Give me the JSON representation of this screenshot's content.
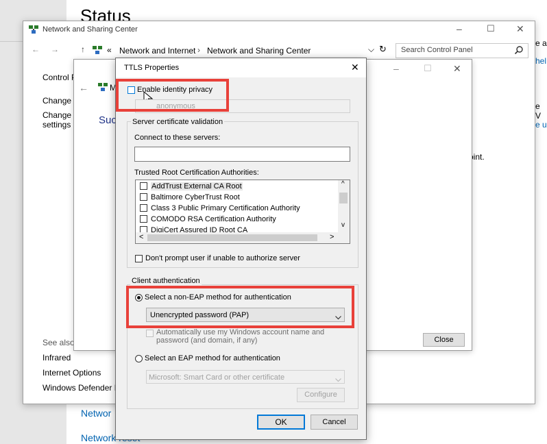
{
  "settings": {
    "title": "Status",
    "links": [
      "Networ",
      "Network reset"
    ],
    "right_fragments": [
      "e a",
      "hel",
      "e V",
      "e us"
    ]
  },
  "nsc": {
    "title": "Network and Sharing Center",
    "titlebar_buttons": {
      "minimize": "–",
      "maximize": "☐",
      "close": "✕"
    },
    "address": {
      "back": "←",
      "forward": "→",
      "up": "↑",
      "overflow": "«",
      "crumb1": "Network and Internet",
      "sep": "›",
      "crumb2": "Network and Sharing Center",
      "dropdown": "⌵",
      "refresh": "↻"
    },
    "search_placeholder": "Search Control Panel",
    "sidebar": {
      "items": [
        "Control P",
        "Change a",
        "Change a",
        "settings"
      ],
      "see_also": "See also",
      "see_also_items": [
        "Infrared",
        "Internet Options",
        "Windows Defender F"
      ]
    },
    "main_fragment": "oint."
  },
  "mid": {
    "title_buttons": {
      "minimize": "–",
      "maximize": "☐",
      "close": "✕"
    },
    "back": "←",
    "label_m": "M",
    "heading_fragment": "Suc",
    "close_button": "Close"
  },
  "ttls": {
    "title": "TTLS Properties",
    "close": "✕",
    "enable_identity_privacy": "Enable identity privacy",
    "identity_value": "anonymous",
    "server_cert_group": "Server certificate validation",
    "connect_label": "Connect to these servers:",
    "connect_value": "",
    "trusted_label": "Trusted Root Certification Authorities:",
    "cas": [
      "AddTrust External CA Root",
      "Baltimore CyberTrust Root",
      "Class 3 Public Primary Certification Authority",
      "COMODO RSA Certification Authority",
      "DigiCert Assured ID Root CA"
    ],
    "dont_prompt": "Don't prompt user if unable to authorize server",
    "client_auth_group": "Client authentication",
    "non_eap_radio": "Select a non-EAP method for authentication",
    "non_eap_selected": "Unencrypted password (PAP)",
    "auto_use_line1": "Automatically use my Windows account name and",
    "auto_use_line2": "password (and domain, if any)",
    "eap_radio": "Select an EAP method for authentication",
    "eap_selected": "Microsoft: Smart Card or other certificate",
    "configure": "Configure",
    "ok": "OK",
    "cancel": "Cancel",
    "scroll": {
      "up": "^",
      "down": "v",
      "left": "<",
      "right": ">"
    }
  },
  "colors": {
    "accent": "#0078d7",
    "highlight": "#e8413a",
    "link": "#0063b1"
  }
}
